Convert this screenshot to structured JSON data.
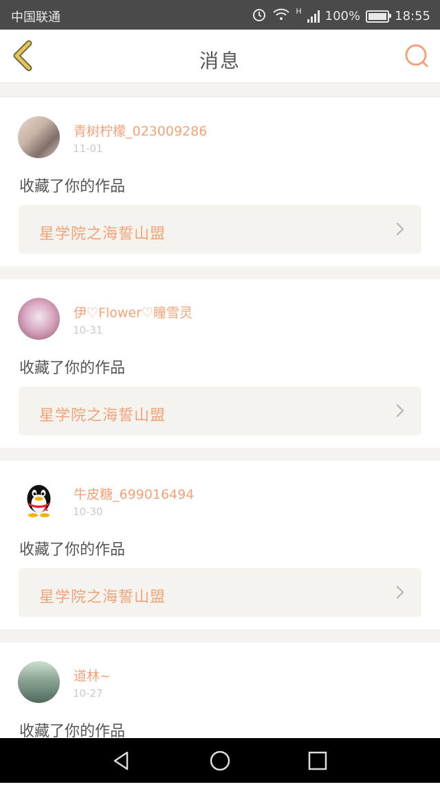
{
  "status_bar": {
    "carrier": "中国联通",
    "battery_text": "100%",
    "time": "18:55",
    "network_label": "H"
  },
  "header": {
    "title": "消息",
    "back_icon": "chevron-left-icon",
    "search_icon": "search-icon"
  },
  "colors": {
    "accent": "#f0a27a",
    "back_arrow": "#e7c25d",
    "text": "#555555",
    "date": "#c9c9c9",
    "card_inner": "#f4f3ee"
  },
  "messages": [
    {
      "username": "青树柠檬_023009286",
      "date": "11-01",
      "action": "收藏了你的作品",
      "work_title": "星学院之海誓山盟"
    },
    {
      "username": "伊♡Flower♡瞳雪灵",
      "date": "10-31",
      "action": "收藏了你的作品",
      "work_title": "星学院之海誓山盟"
    },
    {
      "username": "牛皮糖_699016494",
      "date": "10-30",
      "action": "收藏了你的作品",
      "work_title": "星学院之海誓山盟"
    },
    {
      "username": "道林~",
      "date": "10-27",
      "action": "收藏了你的作品"
    }
  ],
  "nav": {
    "back": "nav-back-icon",
    "home": "nav-home-icon",
    "recents": "nav-recents-icon"
  }
}
